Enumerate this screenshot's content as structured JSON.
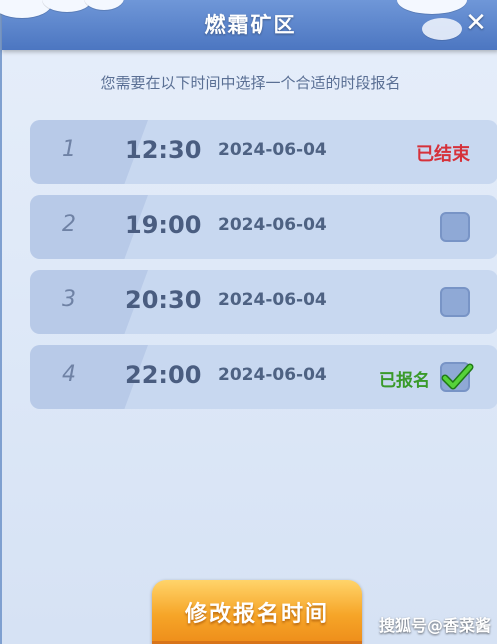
{
  "dialog": {
    "title": "燃霜矿区",
    "close_glyph": "✕",
    "subtitle": "您需要在以下时间中选择一个合适的时段报名"
  },
  "slots": [
    {
      "index": "1",
      "time": "12:30",
      "date": "2024-06-04",
      "status": "已结束",
      "checked": false
    },
    {
      "index": "2",
      "time": "19:00",
      "date": "2024-06-04",
      "status": "",
      "checked": false
    },
    {
      "index": "3",
      "time": "20:30",
      "date": "2024-06-04",
      "status": "",
      "checked": false
    },
    {
      "index": "4",
      "time": "22:00",
      "date": "2024-06-04",
      "status": "已报名",
      "checked": true
    }
  ],
  "action_button": {
    "label": "修改报名时间"
  },
  "watermark": "搜狐号@香菜酱",
  "colors": {
    "header": "#5a83cc",
    "ended": "#d6313a",
    "registered": "#3a9a2a",
    "button": "#f6a528"
  }
}
